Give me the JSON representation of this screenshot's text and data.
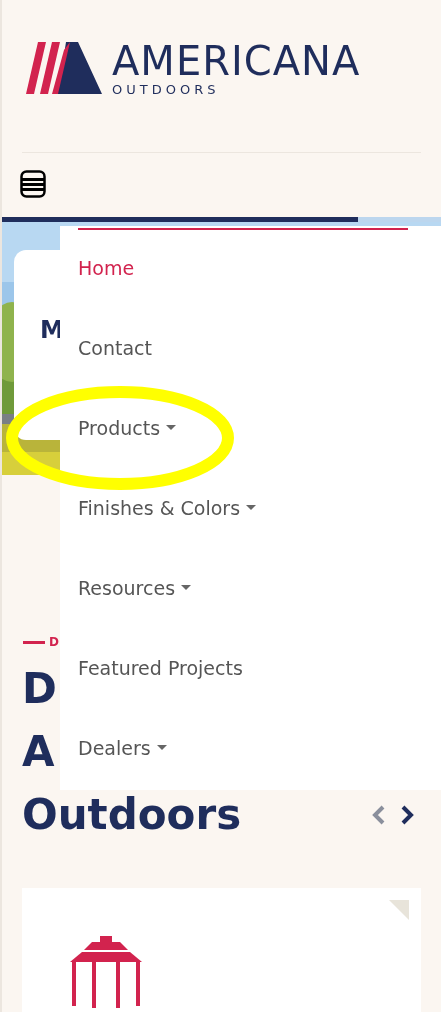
{
  "logo": {
    "name": "AMERICANA",
    "tagline": "OUTDOORS"
  },
  "hero": {
    "card_title": "M"
  },
  "section": {
    "eyebrow": "D",
    "heading_lines": [
      "D",
      "A",
      "Outdoors"
    ]
  },
  "carousel": [
    {
      "kind": "prev",
      "disabled": true
    },
    {
      "kind": "next",
      "disabled": false
    }
  ],
  "menu": [
    {
      "label": "Home",
      "selected": true,
      "has_submenu": false
    },
    {
      "label": "Contact",
      "selected": false,
      "has_submenu": false
    },
    {
      "label": "Products",
      "selected": false,
      "has_submenu": true
    },
    {
      "label": "Finishes & Colors",
      "selected": false,
      "has_submenu": true
    },
    {
      "label": "Resources",
      "selected": false,
      "has_submenu": true
    },
    {
      "label": "Featured Projects",
      "selected": false,
      "has_submenu": false
    },
    {
      "label": "Dealers",
      "selected": false,
      "has_submenu": true
    }
  ]
}
